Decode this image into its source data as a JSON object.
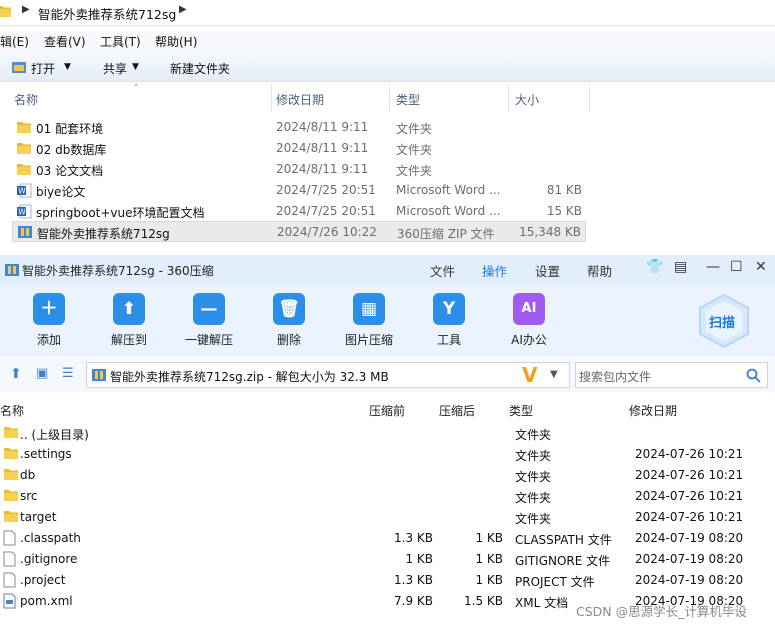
{
  "explorer": {
    "breadcrumb": "智能外卖推荐系统712sg",
    "menu": [
      "辑(E)",
      "查看(V)",
      "工具(T)",
      "帮助(H)"
    ],
    "toolbar": {
      "open": "打开",
      "share": "共享",
      "new_folder": "新建文件夹"
    },
    "columns": {
      "name": "名称",
      "date": "修改日期",
      "type": "类型",
      "size": "大小"
    },
    "files": [
      {
        "name": "01 配套环境",
        "date": "2024/8/11 9:11",
        "type": "文件夹",
        "size": "",
        "icon": "folder-icon"
      },
      {
        "name": "02 db数据库",
        "date": "2024/8/11 9:11",
        "type": "文件夹",
        "size": "",
        "icon": "folder-icon"
      },
      {
        "name": "03 论文文档",
        "date": "2024/8/11 9:11",
        "type": "文件夹",
        "size": "",
        "icon": "folder-icon"
      },
      {
        "name": "biye论文",
        "date": "2024/7/25 20:51",
        "type": "Microsoft Word ...",
        "size": "81 KB",
        "icon": "word-icon"
      },
      {
        "name": "springboot+vue环境配置文档",
        "date": "2024/7/25 20:51",
        "type": "Microsoft Word ...",
        "size": "15 KB",
        "icon": "word-icon"
      },
      {
        "name": "智能外卖推荐系统712sg",
        "date": "2024/7/26 10:22",
        "type": "360压缩 ZIP 文件",
        "size": "15,348 KB",
        "icon": "zip-icon"
      }
    ]
  },
  "zip": {
    "title": "智能外卖推荐系统712sg - 360压缩",
    "tabs": [
      "文件",
      "操作",
      "设置",
      "帮助"
    ],
    "active_tab": "操作",
    "tools": [
      {
        "label": "添加",
        "icon": "add-icon",
        "color": "#2d8ee8"
      },
      {
        "label": "解压到",
        "icon": "extract-icon",
        "color": "#2d8ee8"
      },
      {
        "label": "一键解压",
        "icon": "one-click-extract-icon",
        "color": "#2d8ee8"
      },
      {
        "label": "删除",
        "icon": "delete-icon",
        "color": "#2d8ee8"
      },
      {
        "label": "图片压缩",
        "icon": "image-compress-icon",
        "color": "#2d8ee8"
      },
      {
        "label": "工具",
        "icon": "tools-icon",
        "color": "#2d8ee8"
      },
      {
        "label": "AI办公",
        "icon": "ai-office-icon",
        "color": "#a05cf0",
        "badge": "AI"
      }
    ],
    "scan_label": "扫描",
    "path": "智能外卖推荐系统712sg.zip - 解包大小为 32.3 MB",
    "search_placeholder": "搜索包内文件",
    "columns": {
      "name": "名称",
      "compressed_before": "压缩前",
      "compressed_after": "压缩后",
      "type": "类型",
      "modified": "修改日期"
    },
    "files": [
      {
        "name": ".. (上级目录)",
        "before": "",
        "after": "",
        "type": "文件夹",
        "date": "",
        "icon": "folder-icon"
      },
      {
        "name": ".settings",
        "before": "",
        "after": "",
        "type": "文件夹",
        "date": "2024-07-26 10:21",
        "icon": "folder-icon"
      },
      {
        "name": "db",
        "before": "",
        "after": "",
        "type": "文件夹",
        "date": "2024-07-26 10:21",
        "icon": "folder-icon"
      },
      {
        "name": "src",
        "before": "",
        "after": "",
        "type": "文件夹",
        "date": "2024-07-26 10:21",
        "icon": "folder-icon"
      },
      {
        "name": "target",
        "before": "",
        "after": "",
        "type": "文件夹",
        "date": "2024-07-26 10:21",
        "icon": "folder-icon"
      },
      {
        "name": ".classpath",
        "before": "1.3 KB",
        "after": "1 KB",
        "type": "CLASSPATH 文件",
        "date": "2024-07-19 08:20",
        "icon": "file-icon"
      },
      {
        "name": ".gitignore",
        "before": "1 KB",
        "after": "1 KB",
        "type": "GITIGNORE 文件",
        "date": "2024-07-19 08:20",
        "icon": "file-icon"
      },
      {
        "name": ".project",
        "before": "1.3 KB",
        "after": "1 KB",
        "type": "PROJECT 文件",
        "date": "2024-07-19 08:20",
        "icon": "file-icon"
      },
      {
        "name": "pom.xml",
        "before": "7.9 KB",
        "after": "1.5 KB",
        "type": "XML 文档",
        "date": "2024-07-19 08:20",
        "icon": "xml-icon"
      }
    ],
    "watermark": "CSDN @思源学长_计算机毕设"
  }
}
